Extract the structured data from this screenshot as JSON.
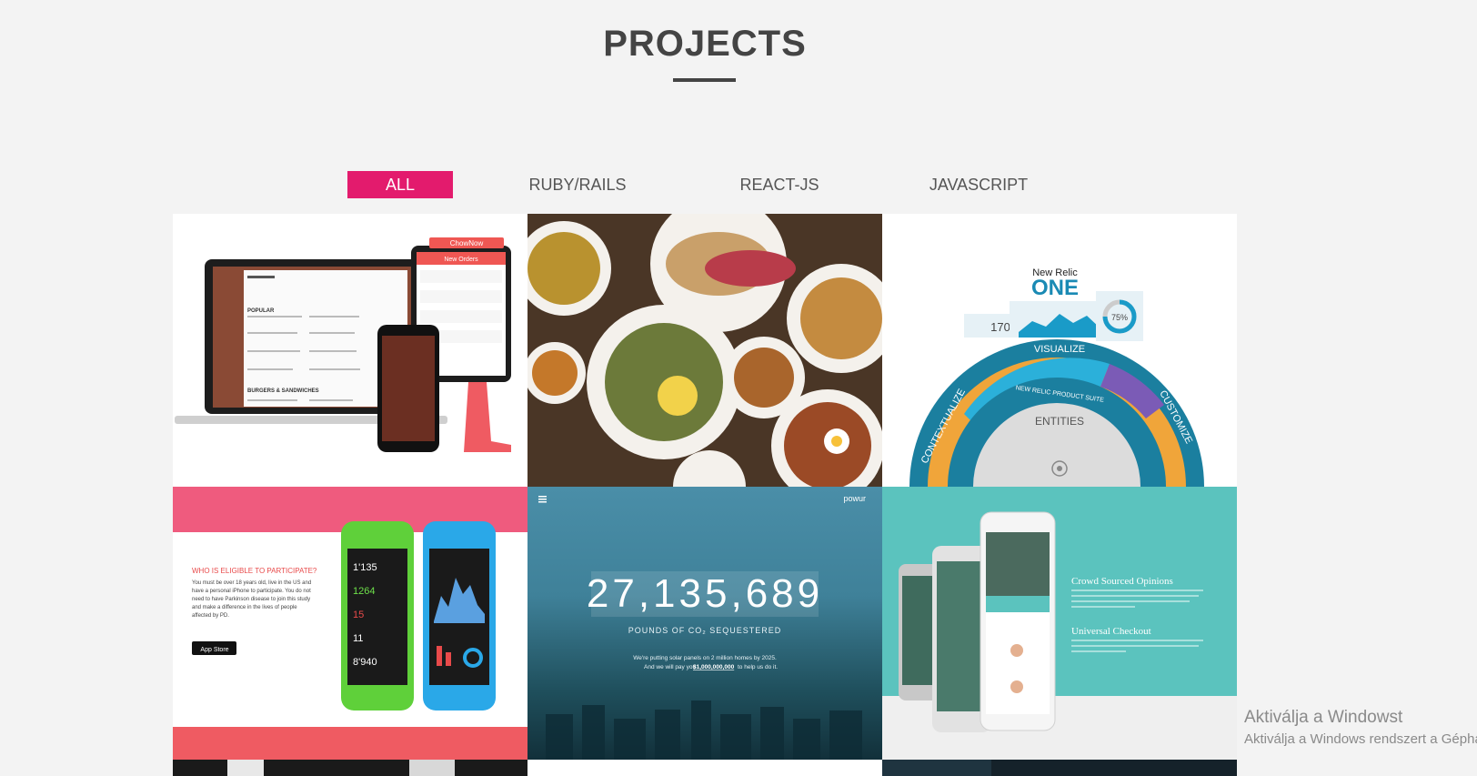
{
  "section": {
    "title": "PROJECTS"
  },
  "filters": [
    {
      "label": "ALL",
      "active": true
    },
    {
      "label": "RUBY/RAILS",
      "active": false
    },
    {
      "label": "REACT-JS",
      "active": false
    },
    {
      "label": "JAVASCRIPT",
      "active": false
    }
  ],
  "accent_color": "#e31b6d",
  "projects": [
    {
      "id": "chownow",
      "brand": "ChowNow",
      "subtitle": "New Orders",
      "menu": {
        "popular": "POPULAR",
        "burgers": "BURGERS & SANDWICHES"
      }
    },
    {
      "id": "food"
    },
    {
      "id": "newrelic",
      "brand": "New Relic",
      "logo": "ONE",
      "metric_value": "170",
      "percent": "75%",
      "ring": {
        "visualize": "VISUALIZE",
        "contextualize": "CONTEXTUALIZE",
        "customize": "CUSTOMIZE",
        "suite": "NEW RELIC PRODUCT SUITE",
        "center": "ENTITIES"
      }
    },
    {
      "id": "pd-study",
      "heading": "WHO IS ELIGIBLE TO PARTICIPATE?",
      "body": "You must be over 18 years old, live in the US and have a personal iPhone to participate. You do not need to have Parkinson disease to join this study and make a difference in the lives of people affected by PD.",
      "store_badge": "App Store",
      "phone_values": [
        "1'135",
        "1264",
        "15",
        "11",
        "8'940"
      ]
    },
    {
      "id": "powur",
      "brand": "powur",
      "counter": "27,135,689",
      "caption": "POUNDS OF CO₂ SEQUESTERED",
      "line1": "We're putting solar panels on 2 million homes by 2025.",
      "line2_pre": "And we will pay you",
      "line2_amount": "$1,000,000,000",
      "line2_post": "to help us do it."
    },
    {
      "id": "crowd",
      "feature1": "Crowd Sourced Opinions",
      "feature2": "Universal Checkout"
    }
  ],
  "watermark": {
    "line1": "Aktiválja a Windowst",
    "line2": "Aktiválja a Windows rendszert a Gépházban."
  }
}
